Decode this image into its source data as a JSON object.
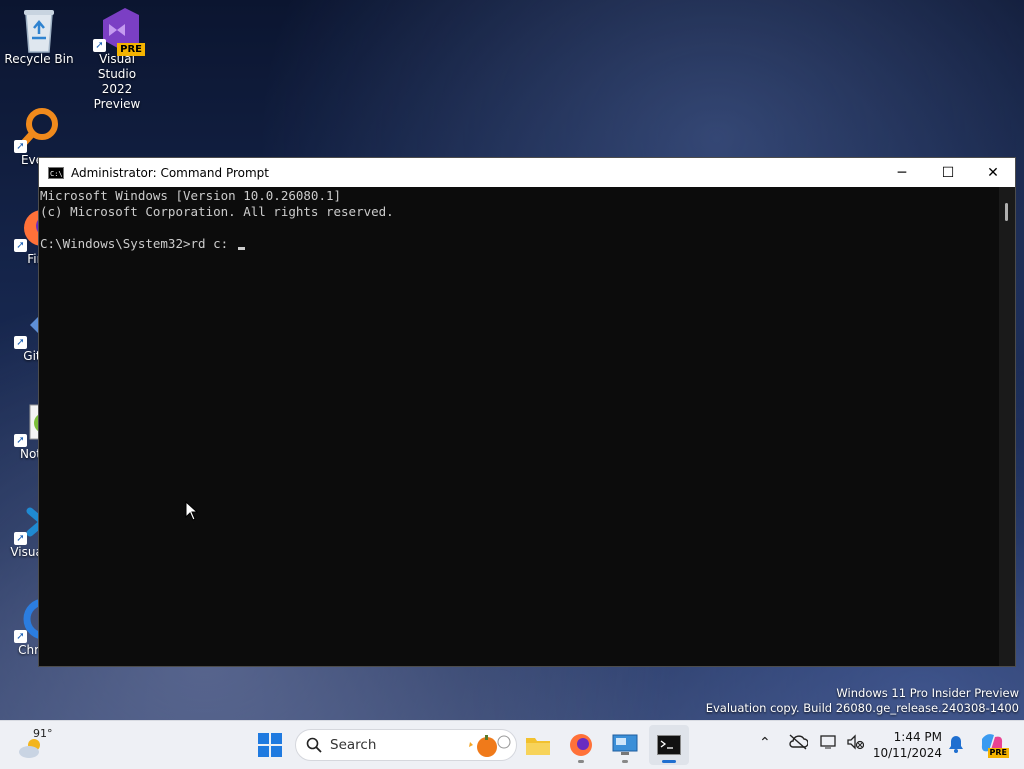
{
  "desktop": {
    "icons": [
      {
        "label": "Recycle Bin"
      },
      {
        "label": "Visual Studio 2022 Preview",
        "badge": "PRE"
      },
      {
        "label": "Every"
      },
      {
        "label": "Fire"
      },
      {
        "label": "Git B"
      },
      {
        "label": "Notep"
      },
      {
        "label": "Visual Co"
      },
      {
        "label": "Chrom"
      }
    ],
    "watermark_line1": "Windows 11 Pro Insider Preview",
    "watermark_line2": "Evaluation copy. Build 26080.ge_release.240308-1400"
  },
  "cmd_window": {
    "title": "Administrator: Command Prompt",
    "icon_text": "C:\\",
    "minimize": "─",
    "maximize": "☐",
    "close": "✕",
    "lines": [
      "Microsoft Windows [Version 10.0.26080.1]",
      "(c) Microsoft Corporation. All rights reserved.",
      "",
      "C:\\Windows\\System32>rd c: "
    ]
  },
  "taskbar": {
    "weather_temp": "91°",
    "search_placeholder": "Search",
    "clock_time": "1:44 PM",
    "clock_date": "10/11/2024",
    "copilot_badge": "PRE"
  },
  "colors": {
    "accent": "#1f6fd0",
    "console_bg": "#0c0c0c",
    "console_fg": "#cccccc",
    "vs_purple": "#7b3fc4",
    "vs_badge": "#f5b400"
  }
}
